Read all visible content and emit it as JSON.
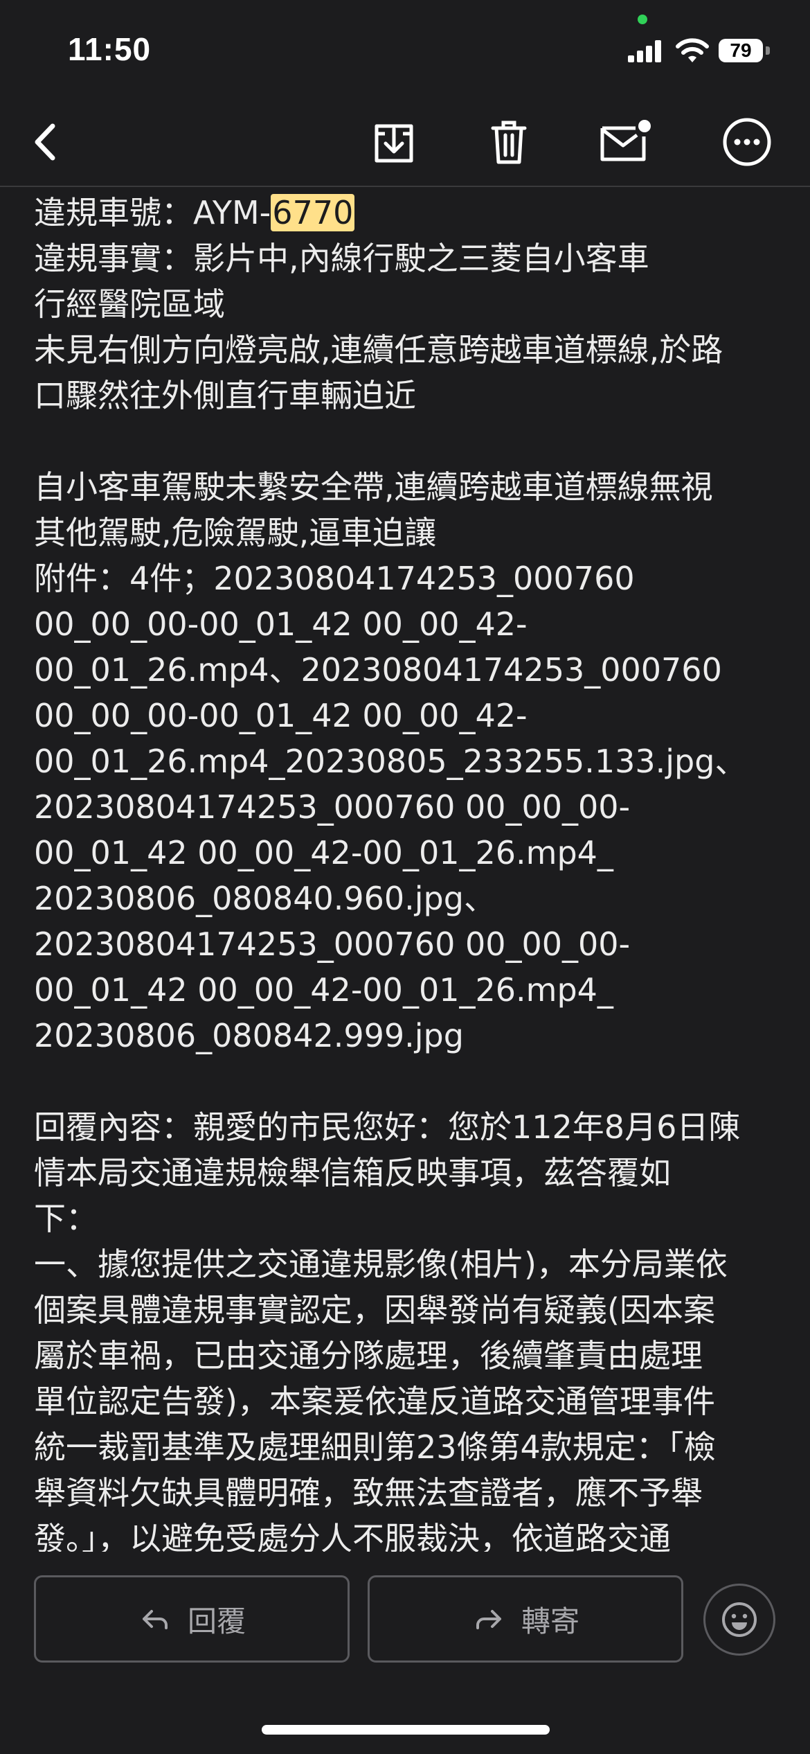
{
  "status_bar": {
    "time": "11:50",
    "battery": "79"
  },
  "toolbar": {
    "back": "back",
    "archive": "archive",
    "delete": "delete",
    "mark_unread": "mark unread",
    "more": "more"
  },
  "email": {
    "plate_prefix": "違規車號：AYM-",
    "plate_highlight": "6770",
    "lines": [
      "違規事實：影片中,內線行駛之三菱自小客車",
      "行經醫院區域",
      "未見右側方向燈亮啟,連續任意跨越車道標線,於路",
      "口驟然往外側直行車輛迫近",
      "",
      "自小客車駕駛未繫安全帶,連續跨越車道標線無視",
      "其他駕駛,危險駕駛,逼車迫讓",
      "附件：4件；20230804174253_000760",
      "00_00_00-00_01_42 00_00_42-",
      "00_01_26.mp4、20230804174253_000760",
      "00_00_00-00_01_42 00_00_42-",
      "00_01_26.mp4_20230805_233255.133.jpg、",
      "20230804174253_000760 00_00_00-",
      "00_01_42 00_00_42-00_01_26.mp4_",
      "20230806_080840.960.jpg、",
      "20230804174253_000760 00_00_00-",
      "00_01_42 00_00_42-00_01_26.mp4_",
      "20230806_080842.999.jpg",
      "",
      "回覆內容：親愛的市民您好：您於112年8月6日陳",
      "情本局交通違規檢舉信箱反映事項，茲答覆如",
      "下：",
      "一、據您提供之交通違規影像(相片)，本分局業依",
      "個案具體違規事實認定，因舉發尚有疑義(因本案",
      "屬於車禍，已由交通分隊處理，後續肇責由處理",
      "單位認定告發)，本案爰依違反道路交通管理事件",
      "統一裁罰基準及處理細則第23條第4款規定：「檢",
      "舉資料欠缺具體明確，致無法查證者，應不予舉",
      "發。」，以避免受處分人不服裁決，依道路交通"
    ]
  },
  "actions": {
    "reply": "回覆",
    "forward": "轉寄",
    "emoji": "emoji reaction"
  },
  "colors": {
    "background": "#1c1c1e",
    "text": "#ececec",
    "highlight": "#ffe08a"
  }
}
